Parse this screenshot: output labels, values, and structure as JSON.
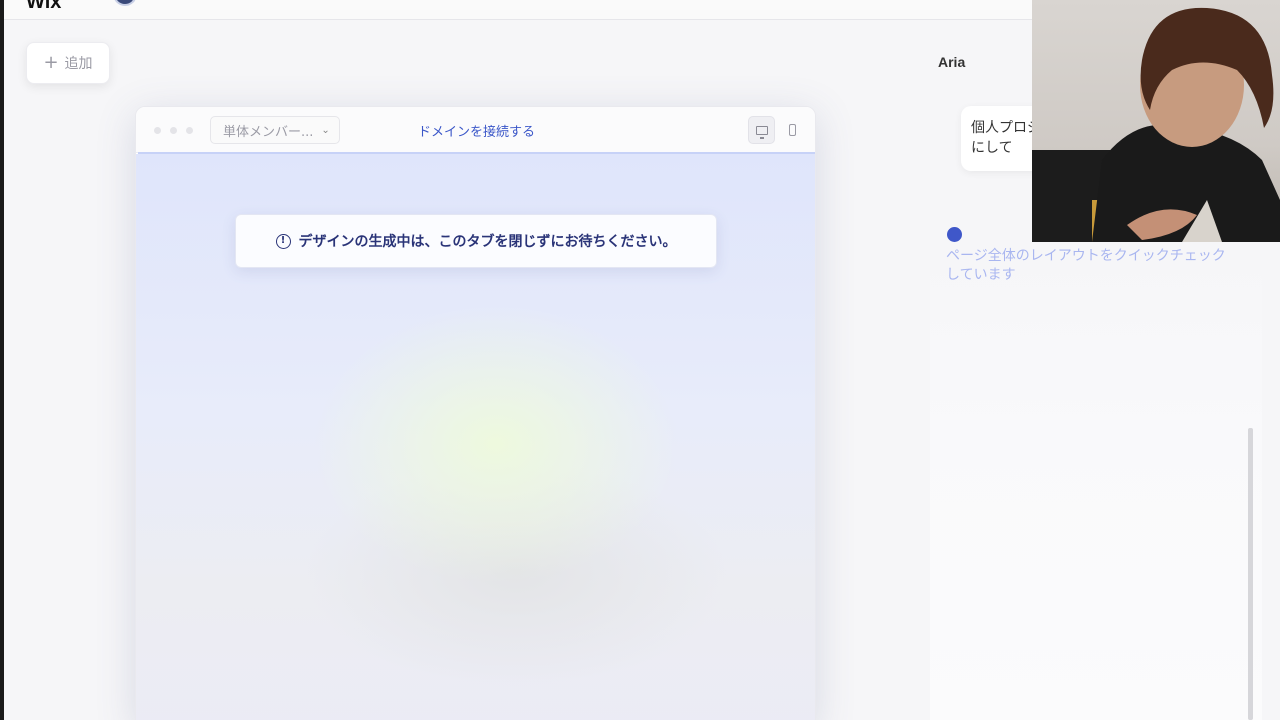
{
  "app": {
    "logo_text": "Wix"
  },
  "toolbar": {
    "add_label": "追加"
  },
  "preview": {
    "member_select_value": "単体メンバー...",
    "domain_link": "ドメインを接続する",
    "notice_text": "デザインの生成中は、このタブを閉じずにお待ちください。"
  },
  "chat": {
    "assistant_name": "Aria",
    "bubble_text": "個人プロジにして",
    "status_text": "ページ全体のレイアウトをクイックチェックしています"
  },
  "colors": {
    "accent": "#3f57c9",
    "link": "#3a56c8",
    "notice_text": "#2a3478"
  }
}
